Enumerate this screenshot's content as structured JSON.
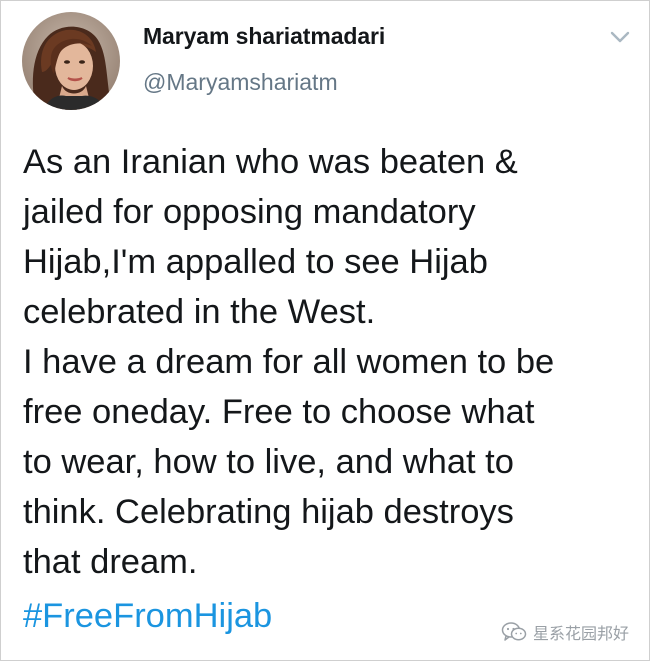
{
  "tweet": {
    "author": {
      "display_name": "Maryam shariatmadari",
      "handle": "@Maryamshariatm",
      "avatar_icon": "profile-photo"
    },
    "menu_icon": "chevron-down-icon",
    "text_lines": [
      "As an Iranian who was beaten &",
      "jailed for opposing mandatory",
      "Hijab,I'm appalled to see Hijab",
      "celebrated in the West.",
      "I have a dream for all women to be",
      "free oneday. Free to choose what",
      "to wear, how to live, and what to",
      "think. Celebrating hijab destroys",
      "that dream."
    ],
    "hashtag": "#FreeFromHijab"
  },
  "watermark": {
    "icon": "wechat-icon",
    "text": "星系花园邦好"
  },
  "colors": {
    "name": "#14171a",
    "handle": "#657786",
    "hashtag": "#1b95e0",
    "caret": "#aab8c2",
    "watermark": "#9aa0a6"
  }
}
